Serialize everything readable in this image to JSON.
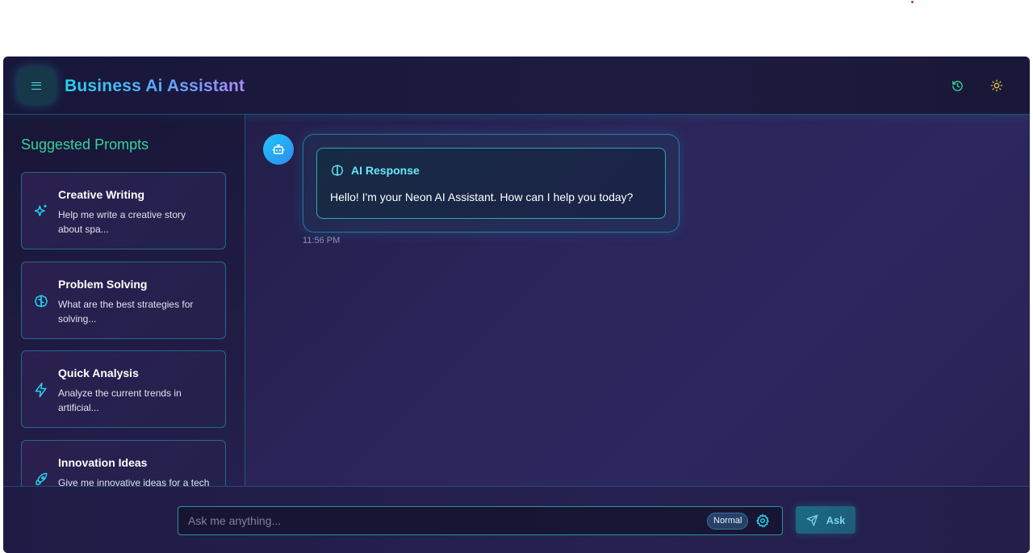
{
  "header": {
    "title": "Business Ai Assistant",
    "icons": [
      "menu-icon",
      "history-icon",
      "sun-icon"
    ]
  },
  "sidebar": {
    "title": "Suggested Prompts",
    "prompts": [
      {
        "title": "Creative Writing",
        "description": "Help me write a creative story about spa...",
        "icon": "sparkles-icon"
      },
      {
        "title": "Problem Solving",
        "description": "What are the best strategies for solving...",
        "icon": "brain-icon"
      },
      {
        "title": "Quick Analysis",
        "description": "Analyze the current trends in artificial...",
        "icon": "lightning-icon"
      },
      {
        "title": "Innovation Ideas",
        "description": "Give me innovative ideas for a tech star...",
        "icon": "rocket-icon"
      }
    ]
  },
  "chat": {
    "messages": [
      {
        "sender": "bot",
        "label": "AI Response",
        "text": "Hello! I'm your Neon AI Assistant. How can I help you today?",
        "time": "11:56 PM"
      }
    ]
  },
  "composer": {
    "placeholder": "Ask me anything...",
    "value": "",
    "mode": "Normal",
    "submit_label": "Ask"
  },
  "colors": {
    "accent_cyan": "#22d3ee",
    "accent_green": "#34d399",
    "title_gradient_end": "#a78bfa",
    "background": "#2a2458"
  }
}
